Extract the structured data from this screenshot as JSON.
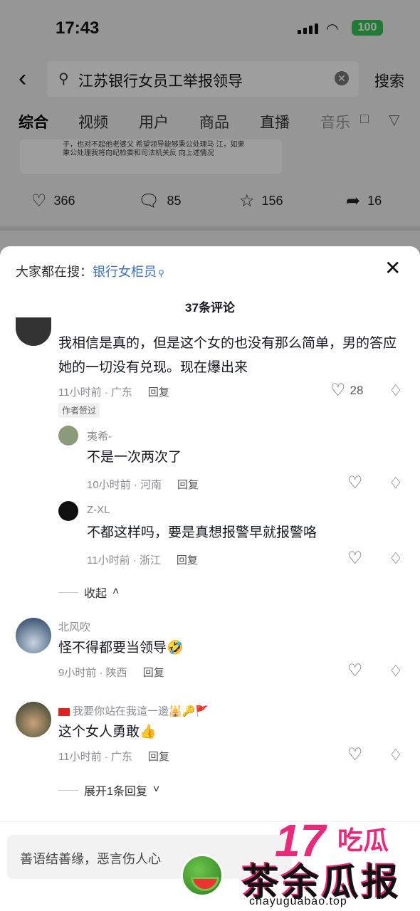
{
  "status_bar": {
    "time": "17:43",
    "battery": "100"
  },
  "search": {
    "query": "江苏银行女员工举报领导",
    "button": "搜索"
  },
  "tabs": [
    "综合",
    "视频",
    "用户",
    "商品",
    "直播",
    "音乐"
  ],
  "video_card": {
    "text": "子，也对不起他老婆父 希望领导能够秉公处理马 江，如果 秉公处理我将向纪检委和司法机关反 向上述情况"
  },
  "post_stats": {
    "likes": "366",
    "comments": "85",
    "favorites": "156",
    "shares": "16"
  },
  "sheet": {
    "trending_label": "大家都在搜：",
    "trending_keyword": "银行女柜员",
    "comment_count": "37条评论"
  },
  "comments": [
    {
      "text": "我相信是真的，但是这个女的也没有那么简单，男的答应她的一切没有兑现。现在爆出来",
      "time_loc": "11小时前 · 广东",
      "reply": "回复",
      "likes": "28",
      "badge": "作者赞过"
    },
    {
      "user": "夷希-",
      "text": "不是一次两次了",
      "time_loc": "10小时前 · 河南",
      "reply": "回复"
    },
    {
      "user": "Z-XL",
      "text": "不都这样吗，要是真想报警早就报警咯",
      "time_loc": "11小时前 · 浙江",
      "reply": "回复"
    },
    {
      "collapse": "收起"
    },
    {
      "user": "北风吹",
      "text": "怪不得都要当领导🤣",
      "time_loc": "9小时前 · 陕西",
      "reply": "回复"
    },
    {
      "user": "我要你站在我這一邊🕌🔑🚩",
      "text": "这个女人勇敢👍",
      "time_loc": "11小时前 · 广东",
      "reply": "回复",
      "expand": "展开1条回复"
    }
  ],
  "input": {
    "placeholder": "善语结善缘，恶言伤人心"
  },
  "watermark": {
    "brand_num": "17",
    "brand_word": "吃瓜",
    "name": "茶余瓜报",
    "url": "chayuguabao.top"
  }
}
